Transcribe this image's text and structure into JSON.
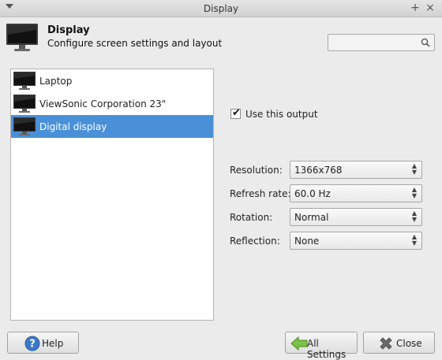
{
  "window": {
    "title": "Display"
  },
  "header": {
    "title": "Display",
    "subtitle": "Configure screen settings and layout"
  },
  "search": {
    "placeholder": ""
  },
  "outputs": [
    {
      "label": "Laptop",
      "selected": false
    },
    {
      "label": "ViewSonic Corporation 23\"",
      "selected": false
    },
    {
      "label": "Digital display",
      "selected": true
    }
  ],
  "use_output": {
    "label": "Use this output",
    "checked": true
  },
  "settings": {
    "resolution": {
      "label": "Resolution:",
      "value": "1366x768"
    },
    "refresh_rate": {
      "label": "Refresh rate:",
      "value": "60.0 Hz"
    },
    "rotation": {
      "label": "Rotation:",
      "value": "Normal"
    },
    "reflection": {
      "label": "Reflection:",
      "value": "None"
    }
  },
  "buttons": {
    "help": "Help",
    "all_settings": "All Settings",
    "close": "Close"
  },
  "colors": {
    "selection": "#4a90d9",
    "help_icon": "#3b79c8",
    "all_settings_icon": "#5fae3a",
    "close_icon": "#6a6a6a"
  }
}
